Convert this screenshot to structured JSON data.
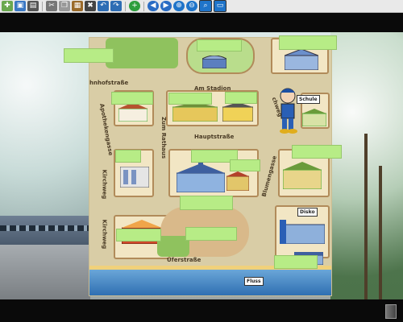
{
  "toolbar": {
    "buttons": [
      {
        "name": "new-icon",
        "color": "#6aa84f"
      },
      {
        "name": "save-icon",
        "color": "#3b78c4"
      },
      {
        "name": "print-icon",
        "color": "#555"
      },
      {
        "name": "cut-icon",
        "color": "#777"
      },
      {
        "name": "copy-icon",
        "color": "#999"
      },
      {
        "name": "paste-icon",
        "color": "#9a6a2a"
      },
      {
        "name": "delete-icon",
        "color": "#444"
      },
      {
        "name": "undo-icon",
        "color": "#2e6db4"
      },
      {
        "name": "redo-icon",
        "color": "#2e6db4"
      },
      {
        "name": "add-icon",
        "color": "#2e9e3d"
      },
      {
        "name": "back-icon",
        "color": "#2a6cc4"
      },
      {
        "name": "forward-icon",
        "color": "#2a6cc4"
      },
      {
        "name": "zoom-in-icon",
        "color": "#1f74c9"
      },
      {
        "name": "zoom-out-icon",
        "color": "#1f74c9"
      },
      {
        "name": "zoom-fit-icon",
        "color": "#1f74c9"
      },
      {
        "name": "monitor-icon",
        "color": "#1f74c9"
      }
    ]
  },
  "map": {
    "streets": {
      "am_stadion": "Am Stadion",
      "bahnhofstrasse": "hnhofstraße",
      "apothekengasse": "Apothekengasse",
      "zum_rathaus": "Zum Rathaus",
      "hauptstrasse": "Hauptstraße",
      "blumengasse": "Blumengasse",
      "kirchweg_top": "Kirchweg",
      "kirchweg_bottom": "Kirchweg",
      "lindenweg": "chweg",
      "uferstrasse": "Uferstraße"
    },
    "labels": {
      "schule": "Schule",
      "disko": "Disko",
      "fluss": "Fluss"
    }
  },
  "colors": {
    "drop_target": "#b7ec86",
    "map_bg": "#d9cda6",
    "block": "#f2e6c4",
    "park": "#8fc25e",
    "river": "#2f6fb2"
  }
}
